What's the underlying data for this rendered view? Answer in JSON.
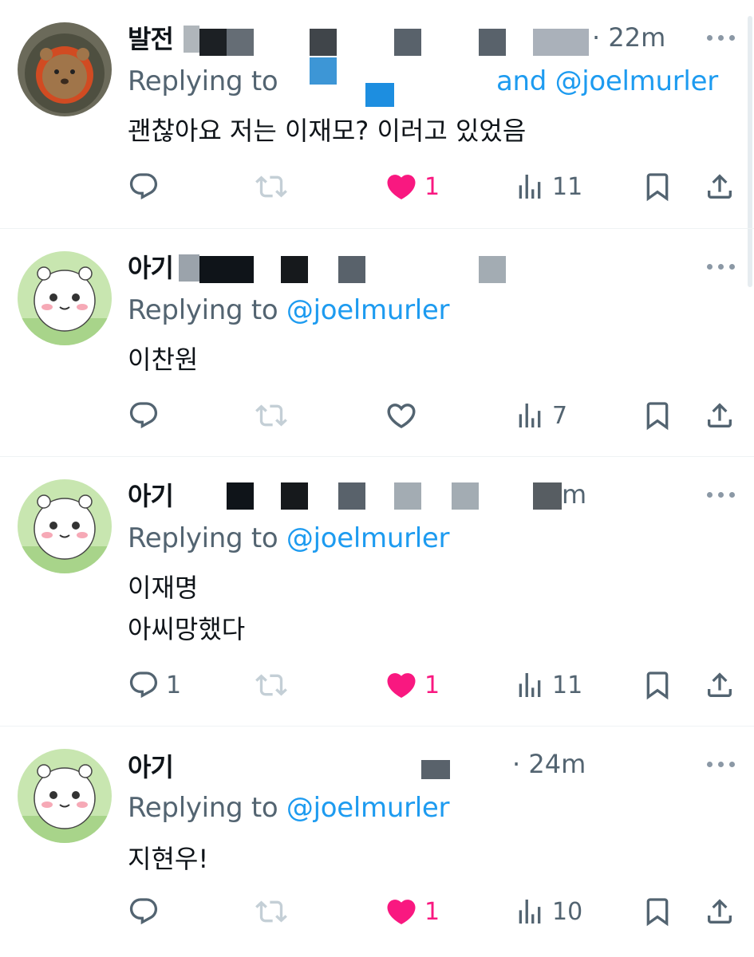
{
  "tweets": [
    {
      "name": "발전",
      "time": "· 22m",
      "replying_prefix": "Replying to",
      "replying_suffix": "and @joelmurler",
      "text": "괜찮아요 저는 이재모? 이러고 있었음",
      "reply_count": "",
      "like_count": "1",
      "view_count": "11",
      "liked": true
    },
    {
      "name": "아기",
      "replying_prefix": "Replying to",
      "handle": "@joelmurler",
      "text": "이찬원",
      "reply_count": "",
      "like_count": "",
      "view_count": "7",
      "liked": false
    },
    {
      "name": "아기",
      "time": "m",
      "replying_prefix": "Replying to",
      "handle": "@joelmurler",
      "text": "이재명\n아씨망했다",
      "reply_count": "1",
      "like_count": "1",
      "view_count": "11",
      "liked": true
    },
    {
      "name": "아기",
      "time": "· 24m",
      "replying_prefix": "Replying to",
      "handle": "@joelmurler",
      "text": "지현우!",
      "reply_count": "",
      "like_count": "1",
      "view_count": "10",
      "liked": true
    }
  ],
  "icons": {
    "reply": "reply-icon",
    "retweet": "retweet-icon",
    "like": "heart-icon",
    "views": "views-icon",
    "bookmark": "bookmark-icon",
    "share": "share-icon",
    "more": "more-icon"
  },
  "colors": {
    "like": "#f91880",
    "link": "#1d9bf0",
    "muted": "#536471"
  }
}
